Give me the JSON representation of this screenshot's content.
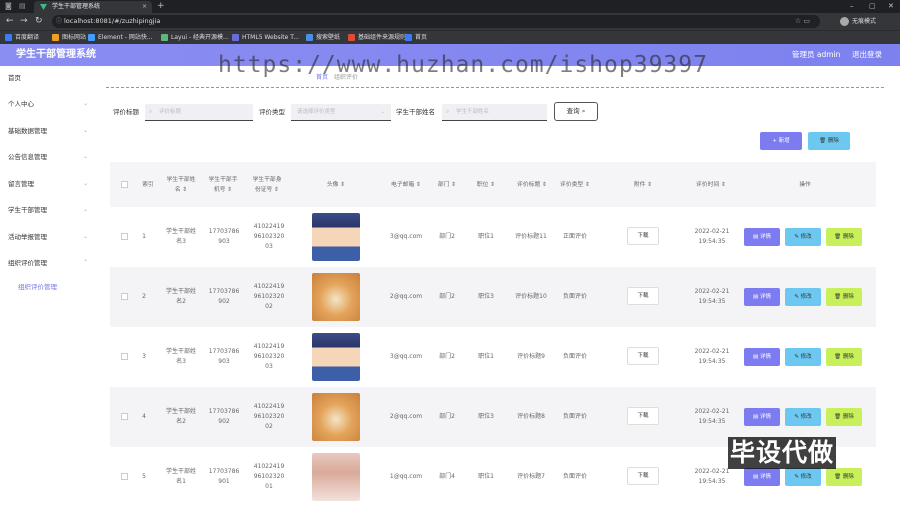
{
  "browser": {
    "tab_title": "学生干部管理系统",
    "tab_close": "×",
    "new_tab": "+",
    "url": "localhost:8081/#/zuzhipingjia",
    "guest_label": "无痕模式",
    "bookmarks": [
      {
        "label": "百度翻译",
        "color": "#3d7af5"
      },
      {
        "label": "图标网站",
        "color": "#f0a020"
      },
      {
        "label": "Element - 网站快...",
        "color": "#409eff"
      },
      {
        "label": "Layui - 经典开源模...",
        "color": "#5fb878"
      },
      {
        "label": "HTML5 Website T...",
        "color": "#6b6bd6"
      },
      {
        "label": "搜索壁纸",
        "color": "#4a90e2"
      },
      {
        "label": "基础组件来源规则",
        "color": "#e04a3a"
      },
      {
        "label": "首页",
        "color": "#3d7af5"
      }
    ]
  },
  "header": {
    "title": "学生干部管理系统",
    "user": "管理员 admin",
    "logout": "退出登录"
  },
  "sidebar": {
    "items": [
      {
        "label": "首页",
        "caret": ""
      },
      {
        "label": "个人中心",
        "caret": "⌄"
      },
      {
        "label": "基础数据管理",
        "caret": "⌄"
      },
      {
        "label": "公告信息管理",
        "caret": "⌄"
      },
      {
        "label": "留言管理",
        "caret": "⌄"
      },
      {
        "label": "学生干部管理",
        "caret": "⌄"
      },
      {
        "label": "活动举报管理",
        "caret": "⌄"
      },
      {
        "label": "组织评价管理",
        "caret": "⌃"
      }
    ],
    "sub_item": "组织评价管理"
  },
  "breadcrumb": {
    "home": "首页",
    "current": "组织评价"
  },
  "watermark": "https://www.huzhan.com/ishop39397",
  "filters": {
    "title_label": "评价标题",
    "title_placeholder": "评价标题",
    "type_label": "评价类型",
    "type_placeholder": "请选择评价类型",
    "name_label": "学生干部姓名",
    "name_placeholder": "学生干部姓名",
    "search_button": "查询"
  },
  "actions": {
    "add": "+ 新增",
    "delete": "删除"
  },
  "table": {
    "headers": [
      "索引",
      "学生干部姓名 ⇕",
      "学生干部手机号 ⇕",
      "学生干部身份证号 ⇕",
      "头像 ⇕",
      "电子邮箱 ⇕",
      "部门 ⇕",
      "职位 ⇕",
      "评价标题 ⇕",
      "评价类型 ⇕",
      "附件 ⇕",
      "评价时间 ⇕",
      "操作"
    ],
    "rows": [
      {
        "index": "1",
        "name": "学生干部姓名3",
        "phone": "17703786903",
        "idcard": "410224199610232003",
        "avatar": "conan",
        "email": "3@qq.com",
        "dept": "部门2",
        "position": "职位1",
        "title": "评价标题11",
        "type": "正面评价",
        "time": "2022-02-21 19:54:35"
      },
      {
        "index": "2",
        "name": "学生干部姓名2",
        "phone": "17703786902",
        "idcard": "410224199610232002",
        "avatar": "dog",
        "email": "2@qq.com",
        "dept": "部门2",
        "position": "职位3",
        "title": "评价标题10",
        "type": "负面评价",
        "time": "2022-02-21 19:54:35"
      },
      {
        "index": "3",
        "name": "学生干部姓名3",
        "phone": "17703786903",
        "idcard": "410224199610232003",
        "avatar": "conan",
        "email": "3@qq.com",
        "dept": "部门2",
        "position": "职位1",
        "title": "评价标题9",
        "type": "负面评价",
        "time": "2022-02-21 19:54:35"
      },
      {
        "index": "4",
        "name": "学生干部姓名2",
        "phone": "17703786902",
        "idcard": "410224199610232002",
        "avatar": "dog",
        "email": "2@qq.com",
        "dept": "部门2",
        "position": "职位3",
        "title": "评价标题8",
        "type": "负面评价",
        "time": "2022-02-21 19:54:35"
      },
      {
        "index": "5",
        "name": "学生干部姓名1",
        "phone": "17703786901",
        "idcard": "410224199610232001",
        "avatar": "girl",
        "email": "1@qq.com",
        "dept": "部门4",
        "position": "职位1",
        "title": "评价标题7",
        "type": "负面评价",
        "time": "2022-02-21 19:54:35"
      }
    ],
    "download_label": "下载",
    "detail_label": "详情",
    "edit_label": "修改",
    "delete_label": "删除"
  },
  "overlay_text": "毕设代做",
  "colors": {
    "accent": "#7c7cf0",
    "info": "#6cc8f0",
    "danger_light": "#c8f05a"
  }
}
